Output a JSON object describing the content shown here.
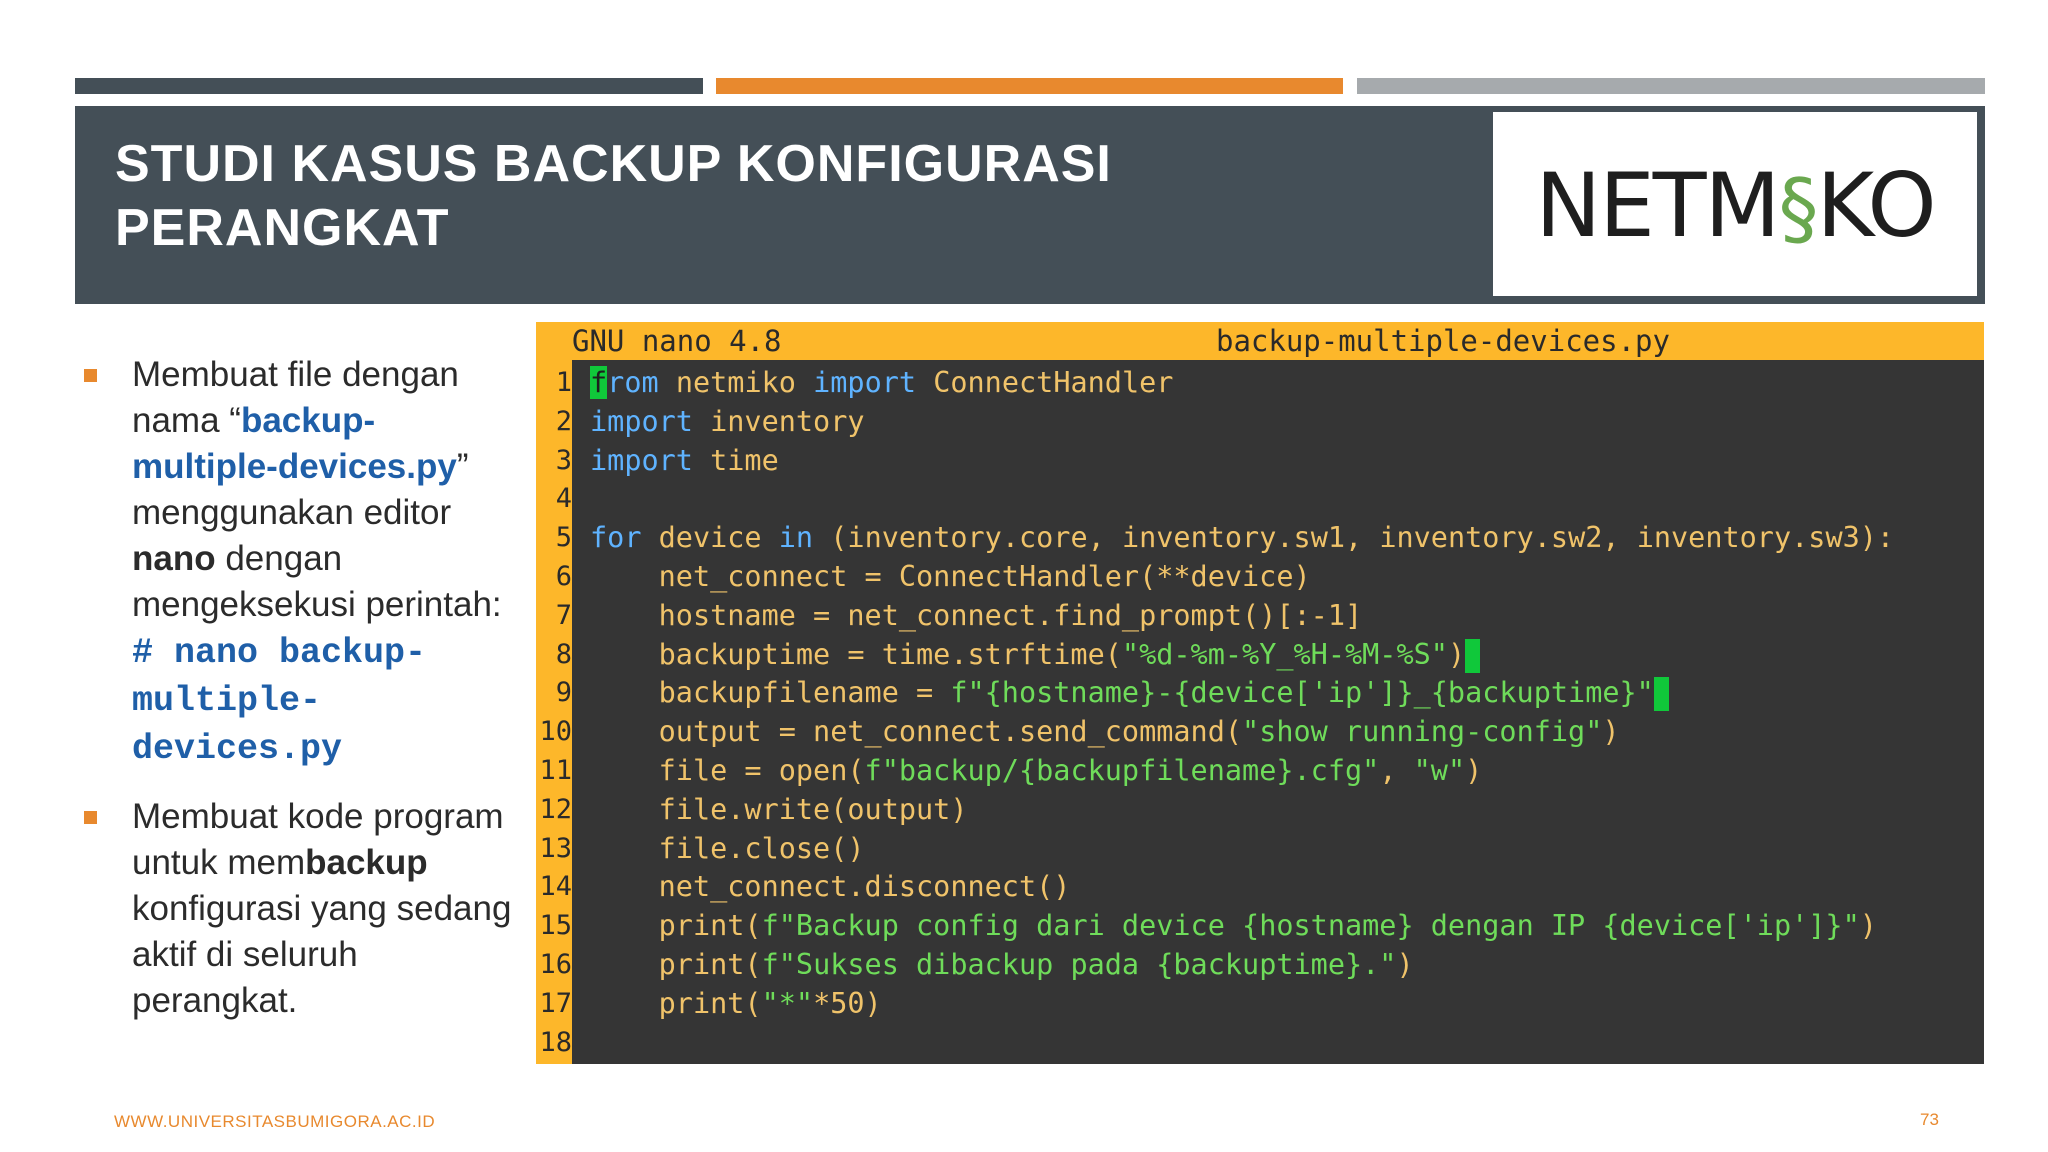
{
  "slide": {
    "title_line1": "STUDI KASUS BACKUP KONFIGURASI",
    "title_line2": "PERANGKAT",
    "logo": {
      "pre": "NETM",
      "mid": "§",
      "post": "KO"
    }
  },
  "bullets": [
    {
      "t1": "Membuat file dengan nama “",
      "file": "backup-multiple-devices.py",
      "t2": "” menggunakan editor ",
      "editor": "nano",
      "t3": " dengan mengeksekusi perintah: ",
      "command": "# nano backup-multiple-devices.py"
    },
    {
      "t1": "Membuat kode program untuk mem",
      "bold": "backup",
      "t2": " konfigurasi yang sedang aktif di seluruh perangkat."
    }
  ],
  "editor": {
    "version": "GNU nano 4.8",
    "filename": "backup-multiple-devices.py",
    "line_numbers": [
      "1",
      "2",
      "3",
      "4",
      "5",
      "6",
      "7",
      "8",
      "9",
      "10",
      "11",
      "12",
      "13",
      "14",
      "15",
      "16",
      "17",
      "18"
    ],
    "l1": {
      "c": "f",
      "a": "rom",
      "b": " netmiko ",
      "d": "import",
      "e": " ConnectHandler"
    },
    "l2": {
      "a": "import",
      "b": " inventory"
    },
    "l3": {
      "a": "import",
      "b": " time"
    },
    "l5": {
      "a": "for",
      "b": " device ",
      "c": "in",
      "d": " (inventory.core, inventory.sw1, inventory.sw2, inventory.sw3):"
    },
    "l6": "    net_connect = ConnectHandler(**device)",
    "l7": "    hostname = net_connect.find_prompt()[:-1]",
    "l8": {
      "a": "    backuptime = time.strftime(",
      "b": "\"%d-%m-%Y_%H-%M-%S\"",
      "c": ")"
    },
    "l9": {
      "a": "    backupfilename = ",
      "b": "f\"{hostname}-{device['ip']}_{backuptime}\""
    },
    "l10": {
      "a": "    output = net_connect.send_command(",
      "b": "\"show running-config\"",
      "c": ")"
    },
    "l11": {
      "a": "    file = open(",
      "b": "f\"backup/{backupfilename}.cfg\"",
      "c": ", ",
      "d": "\"w\"",
      "e": ")"
    },
    "l12": "    file.write(output)",
    "l13": "    file.close()",
    "l14": "    net_connect.disconnect()",
    "l15": {
      "a": "    print(",
      "b": "f\"Backup config dari device {hostname} dengan IP {device['ip']}\"",
      "c": ")"
    },
    "l16": {
      "a": "    print(",
      "b": "f\"Sukses dibackup pada {backuptime}.\"",
      "c": ")"
    },
    "l17": {
      "a": "    print(",
      "b": "\"*\"",
      "c": "*50)"
    }
  },
  "footer": {
    "url": "WWW.UNIVERSITASBUMIGORA.AC.ID",
    "page": "73"
  },
  "colors": {
    "accent": "#e8892e",
    "header_bg": "#444f57",
    "link_blue": "#1f5fa8",
    "nano_bar": "#fdb72a",
    "editor_bg": "#353535"
  }
}
